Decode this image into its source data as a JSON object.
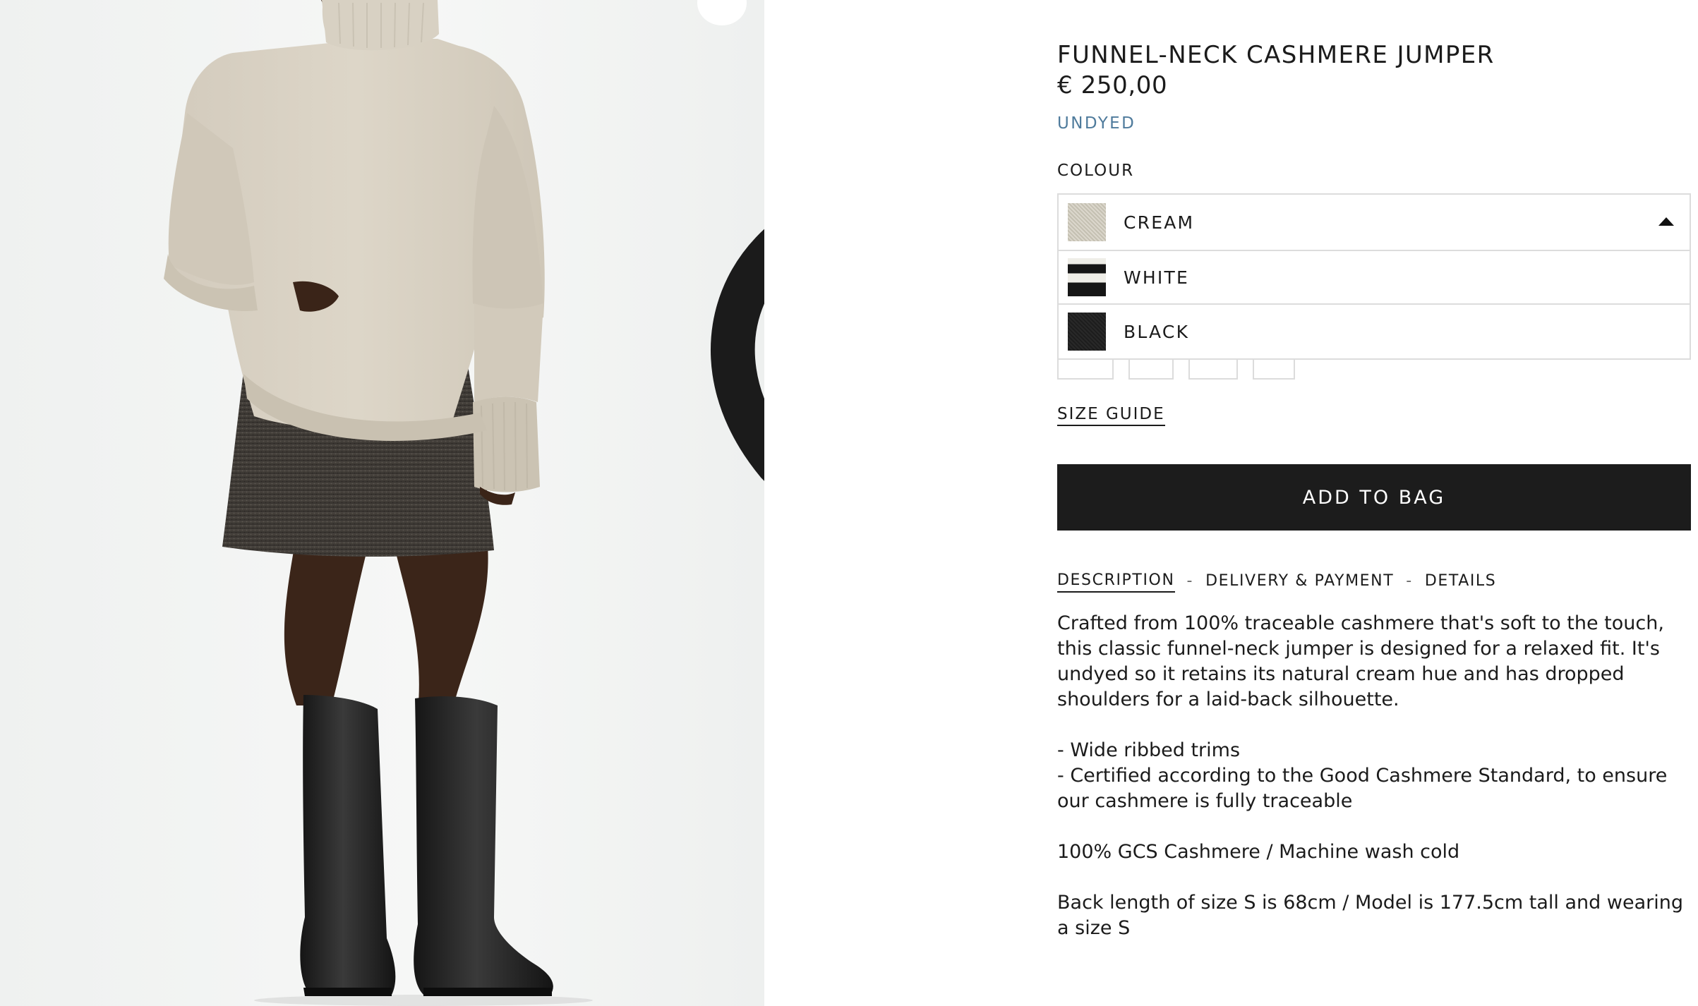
{
  "gallery": {
    "favourite_icon": "heart-icon"
  },
  "product": {
    "title": "FUNNEL-NECK CASHMERE JUMPER",
    "price": "€ 250,00",
    "tag": "UNDYED"
  },
  "colour": {
    "label": "COLOUR",
    "selected": "CREAM",
    "options": [
      {
        "label": "WHITE"
      },
      {
        "label": "BLACK"
      }
    ],
    "caret_icon": "caret-up-icon",
    "swatch_colors": {
      "cream": "#cfcabb",
      "white": "#efeee8",
      "black": "#1d1d1d"
    }
  },
  "size_guide": "SIZE GUIDE",
  "add_to_bag": "ADD TO BAG",
  "tabs": [
    "DESCRIPTION",
    "DELIVERY & PAYMENT",
    "DETAILS"
  ],
  "tab_separator": "-",
  "description": {
    "paragraph": "Crafted from 100% traceable cashmere that's soft to the touch, this classic funnel-neck jumper is designed for a relaxed fit. It's undyed so it retains its natural cream hue and has dropped shoulders for a laid-back silhouette.",
    "bullets": [
      "- Wide ribbed trims",
      "- Certified according to the Good Cashmere Standard, to ensure our cashmere is fully traceable"
    ],
    "composition": "100% GCS Cashmere / Machine wash cold",
    "fit": "Back length of size S is 68cm / Model is 177.5cm tall and wearing a size S"
  },
  "colors": {
    "accent_blue": "#4f7b9c",
    "button_bg": "#1c1c1c",
    "text": "#1b1b1b",
    "border": "#dcdcdc"
  }
}
